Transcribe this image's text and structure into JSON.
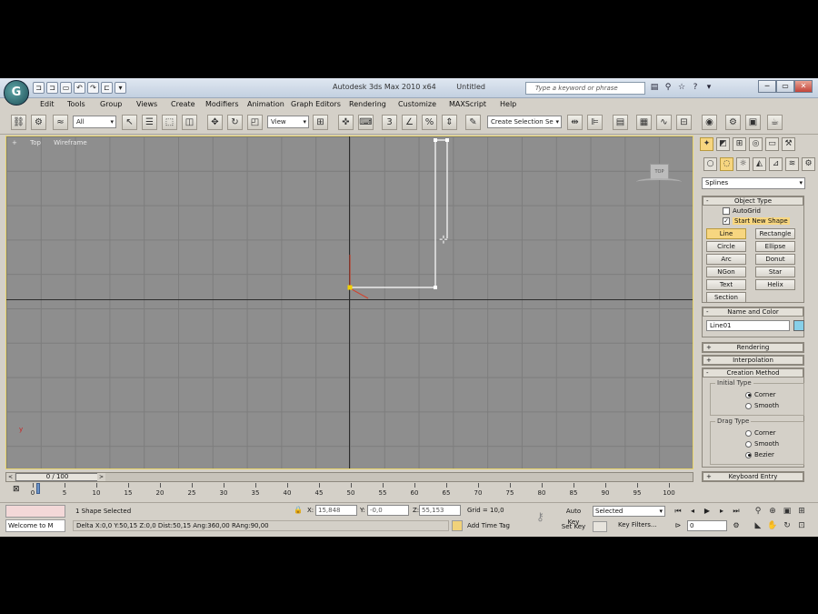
{
  "titlebar": {
    "app_title": "Autodesk 3ds Max 2010 x64",
    "doc_title": "Untitled",
    "search_placeholder": "Type a keyword or phrase",
    "qat": [
      "⊐",
      "⊐",
      "▭",
      "↶",
      "↷",
      "⊏"
    ],
    "qat_dropdown": "▾",
    "help_icons": [
      "▤",
      "⚲",
      "☆",
      "?",
      "▾"
    ],
    "win_buttons": [
      "─",
      "▭",
      "✕"
    ],
    "logo": "G"
  },
  "menu": [
    "Edit",
    "Tools",
    "Group",
    "Views",
    "Create",
    "Modifiers",
    "Animation",
    "Graph Editors",
    "Rendering",
    "Customize",
    "MAXScript",
    "Help"
  ],
  "toolbar": {
    "filter_dd": "All",
    "refcoord_dd": "View",
    "selection_set_dd": "Create Selection Se"
  },
  "viewport": {
    "label": [
      "+",
      "Top",
      "Wireframe"
    ],
    "viewcube_label": "TOP",
    "tripod_label": "y"
  },
  "command_panel": {
    "category": "Splines",
    "object_type": {
      "title": "Object Type",
      "autogrid": "AutoGrid",
      "start_new_shape": "Start New Shape",
      "buttons": [
        "Line",
        "Rectangle",
        "Circle",
        "Ellipse",
        "Arc",
        "Donut",
        "NGon",
        "Star",
        "Text",
        "Helix",
        "Section"
      ]
    },
    "name_color": {
      "title": "Name and Color",
      "name": "Line01"
    },
    "rendering": "Rendering",
    "interpolation": "Interpolation",
    "creation_method": {
      "title": "Creation Method",
      "initial_type": "Initial Type",
      "initial_options": [
        "Corner",
        "Smooth"
      ],
      "drag_type": "Drag Type",
      "drag_options": [
        "Corner",
        "Smooth",
        "Bezier"
      ]
    },
    "keyboard_entry": "Keyboard Entry"
  },
  "timeslider": {
    "thumb": "0 / 100",
    "left_arrow": "<",
    "right_arrow": ">"
  },
  "trackbar": {
    "ticks": [
      "0",
      "5",
      "10",
      "15",
      "20",
      "25",
      "30",
      "35",
      "40",
      "45",
      "50",
      "55",
      "60",
      "65",
      "70",
      "75",
      "80",
      "85",
      "90",
      "95",
      "100"
    ]
  },
  "status": {
    "welcome": "Welcome to M",
    "selection": "1 Shape Selected",
    "prompt": "Delta X:0,0  Y:50,15  Z:0,0  Dist:50,15  Ang:360,00  RAng:90,00",
    "x_label": "X:",
    "x_value": "15,848",
    "y_label": "Y:",
    "y_value": "-0,0",
    "z_label": "Z:",
    "z_value": "55,153",
    "grid": "Grid = 10,0",
    "add_time_tag": "Add Time Tag",
    "auto_key": "Auto Key",
    "auto_key_value": "Selected",
    "set_key": "Set Key",
    "key_filters": "Key Filters...",
    "frame": "0"
  }
}
